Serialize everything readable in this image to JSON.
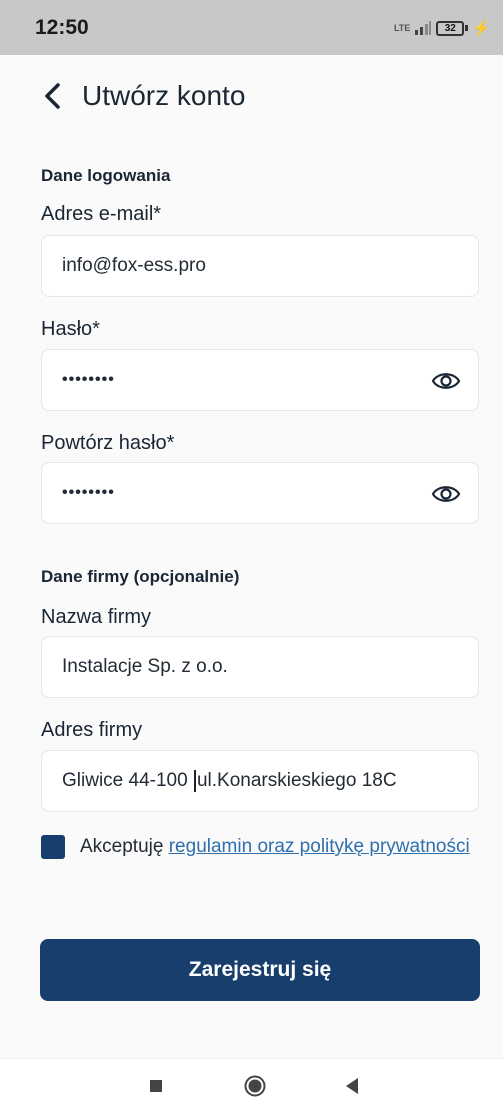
{
  "status_bar": {
    "time": "12:50",
    "network": "LTE",
    "battery": "32",
    "battery_level": 0.32
  },
  "header": {
    "title": "Utwórz konto"
  },
  "login_section": {
    "title": "Dane logowania",
    "email": {
      "label": "Adres e-mail*",
      "value": "info@fox-ess.pro"
    },
    "password": {
      "label": "Hasło*",
      "value": "••••••••"
    },
    "password_repeat": {
      "label": "Powtórz hasło*",
      "value": "••••••••"
    }
  },
  "company_section": {
    "title": "Dane firmy (opcjonalnie)",
    "company_name": {
      "label": "Nazwa firmy",
      "value": "Instalacje Sp. z o.o."
    },
    "company_address": {
      "label": "Adres firmy",
      "value_before_cursor": "Gliwice 44-100 ",
      "value_after_cursor": "ul.Konarskieskiego 18C"
    }
  },
  "terms": {
    "prefix": "Akceptuję ",
    "link": "regulamin oraz politykę prywatności",
    "checked": true
  },
  "register_button": {
    "label": "Zarejestruj się"
  },
  "nav_bar": {
    "icons": [
      "recents-icon",
      "home-icon",
      "back-icon"
    ]
  },
  "colors": {
    "primary": "#173e6c",
    "link": "#2f6fae",
    "background": "#fafafa"
  }
}
